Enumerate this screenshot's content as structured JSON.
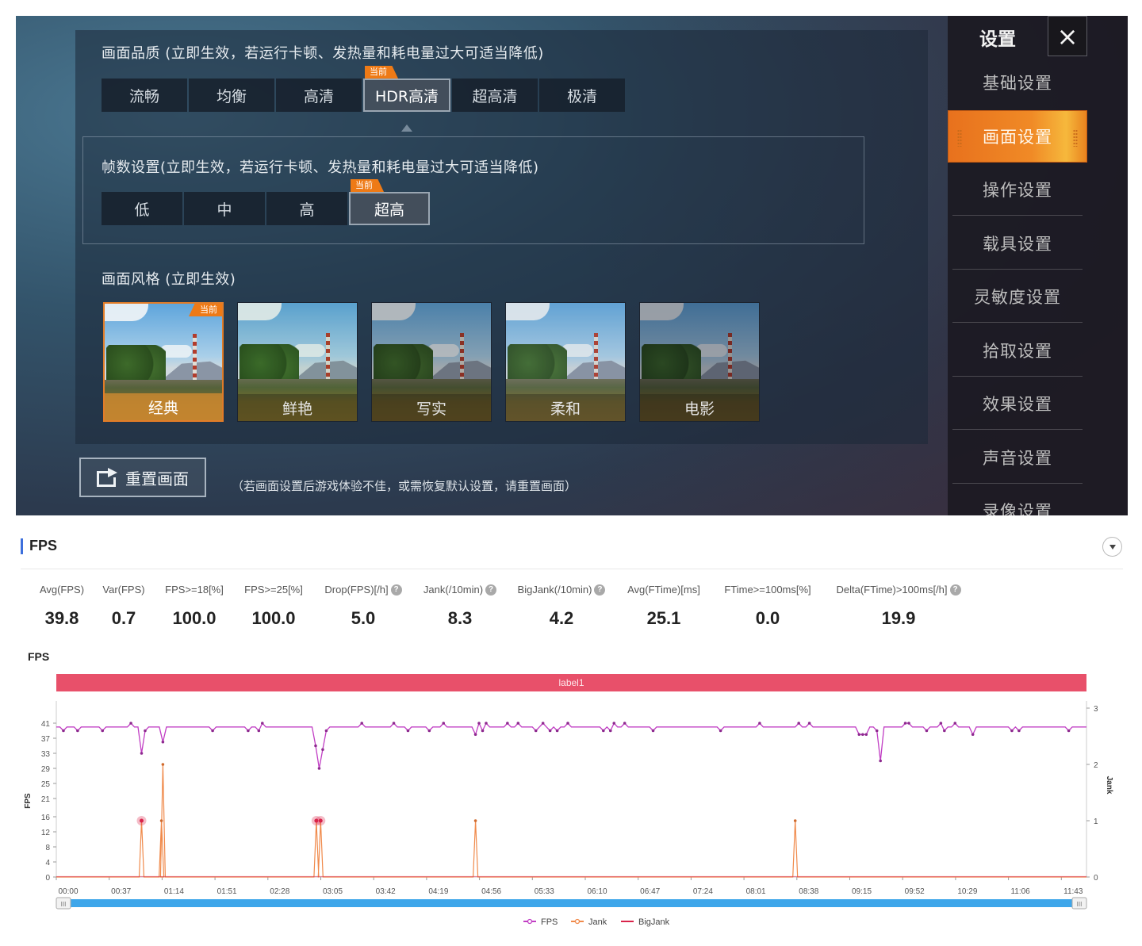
{
  "game": {
    "quality": {
      "title": "画面品质 (立即生效，若运行卡顿、发热量和耗电量过大可适当降低)",
      "options": [
        "流畅",
        "均衡",
        "高清",
        "HDR高清",
        "超高清",
        "极清"
      ],
      "selected_index": 3
    },
    "current_tag": "当前",
    "framerate": {
      "title": "帧数设置(立即生效，若运行卡顿、发热量和耗电量过大可适当降低)",
      "options": [
        "低",
        "中",
        "高",
        "超高"
      ],
      "selected_index": 3
    },
    "style": {
      "title": "画面风格 (立即生效)",
      "options": [
        "经典",
        "鲜艳",
        "写实",
        "柔和",
        "电影"
      ],
      "selected_index": 0
    },
    "reset_button": "重置画面",
    "reset_hint": "（若画面设置后游戏体验不佳，或需恢复默认设置，请重置画面）",
    "sidebar": {
      "title": "设置",
      "close_icon": "×",
      "items": [
        "基础设置",
        "画面设置",
        "操作设置",
        "载具设置",
        "灵敏度设置",
        "拾取设置",
        "效果设置",
        "声音设置",
        "录像设置"
      ],
      "active_index": 1
    }
  },
  "fps_panel": {
    "title": "FPS",
    "metrics": [
      {
        "label": "Avg(FPS)",
        "value": "39.8",
        "help": false
      },
      {
        "label": "Var(FPS)",
        "value": "0.7",
        "help": false
      },
      {
        "label": "FPS>=18[%]",
        "value": "100.0",
        "help": false
      },
      {
        "label": "FPS>=25[%]",
        "value": "100.0",
        "help": false
      },
      {
        "label": "Drop(FPS)[/h]",
        "value": "5.0",
        "help": true
      },
      {
        "label": "Jank(/10min)",
        "value": "8.3",
        "help": true
      },
      {
        "label": "BigJank(/10min)",
        "value": "4.2",
        "help": true
      },
      {
        "label": "Avg(FTime)[ms]",
        "value": "25.1",
        "help": false
      },
      {
        "label": "FTime>=100ms[%]",
        "value": "0.0",
        "help": false
      },
      {
        "label": "Delta(FTime)>100ms[/h]",
        "value": "19.9",
        "help": true
      }
    ],
    "chart_title": "FPS"
  },
  "chart_data": {
    "type": "line",
    "title": "FPS",
    "band_label": "label1",
    "band_color": "#e8506a",
    "xlabel": "",
    "ylabel": "FPS",
    "y2label": "Jank",
    "x_ticks": [
      "00:00",
      "00:37",
      "01:14",
      "01:51",
      "02:28",
      "03:05",
      "03:42",
      "04:19",
      "04:56",
      "05:33",
      "06:10",
      "06:47",
      "07:24",
      "08:01",
      "08:38",
      "09:15",
      "09:52",
      "10:29",
      "11:06",
      "11:43"
    ],
    "x_range_seconds": [
      0,
      725
    ],
    "y_ticks": [
      0,
      4,
      8,
      12,
      16,
      21,
      25,
      29,
      33,
      37,
      41
    ],
    "ylim": [
      0,
      43
    ],
    "y2_ticks": [
      0,
      1,
      2,
      3
    ],
    "y2lim": [
      0,
      3
    ],
    "legend": [
      "FPS",
      "Jank",
      "BigJank"
    ],
    "legend_position": "bottom-center",
    "series_colors": {
      "FPS": "#c13ec4",
      "Jank": "#f08a4b",
      "BigJank": "#d9234a"
    },
    "fps_baseline": 40,
    "fps_dips": [
      {
        "t": 59,
        "fps": 33
      },
      {
        "t": 74,
        "fps": 36
      },
      {
        "t": 75,
        "fps": 38
      },
      {
        "t": 183,
        "fps": 35
      },
      {
        "t": 184,
        "fps": 29
      },
      {
        "t": 185,
        "fps": 39
      },
      {
        "t": 186,
        "fps": 33
      },
      {
        "t": 187,
        "fps": 34
      },
      {
        "t": 295,
        "fps": 38
      },
      {
        "t": 565,
        "fps": 38
      },
      {
        "t": 568,
        "fps": 38
      },
      {
        "t": 570,
        "fps": 38
      },
      {
        "t": 580,
        "fps": 31
      },
      {
        "t": 645,
        "fps": 38
      }
    ],
    "jank_events": [
      {
        "t": 60,
        "jank": 1
      },
      {
        "t": 74,
        "jank": 1
      },
      {
        "t": 75,
        "jank": 2
      },
      {
        "t": 183,
        "jank": 1
      },
      {
        "t": 186,
        "jank": 1
      },
      {
        "t": 295,
        "jank": 1
      },
      {
        "t": 520,
        "jank": 1
      }
    ],
    "bigjank_events": [
      {
        "t": 60,
        "bigjank": 1
      },
      {
        "t": 183,
        "bigjank": 1
      },
      {
        "t": 186,
        "bigjank": 1
      }
    ],
    "zoom_slider": {
      "start": 0,
      "end": 100
    }
  }
}
